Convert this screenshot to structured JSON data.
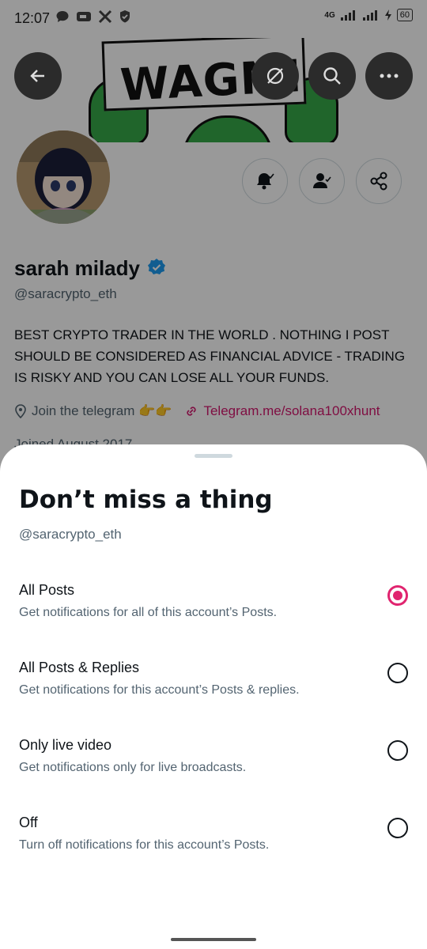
{
  "status_bar": {
    "time": "12:07",
    "network": "4G",
    "battery": "60"
  },
  "banner": {
    "sign_text": "WAGMI"
  },
  "profile": {
    "name": "sarah milady",
    "handle": "@saracrypto_eth",
    "bio": "BEST CRYPTO TRADER IN THE WORLD . NOTHING I POST SHOULD BE CONSIDERED AS FINANCIAL ADVICE - TRADING IS RISKY AND YOU CAN LOSE ALL YOUR FUNDS.",
    "location": "Join the telegram 👉👉",
    "link": "Telegram.me/solana100xhunt",
    "joined": "Joined August 2017"
  },
  "sheet": {
    "title": "Don’t miss a thing",
    "subtitle": "@saracrypto_eth",
    "options": [
      {
        "title": "All Posts",
        "desc": "Get notifications for all of this account’s Posts.",
        "selected": true
      },
      {
        "title": "All Posts & Replies",
        "desc": "Get notifications for this account’s Posts & replies.",
        "selected": false
      },
      {
        "title": "Only live video",
        "desc": "Get notifications only for live broadcasts.",
        "selected": false
      },
      {
        "title": "Off",
        "desc": "Turn off notifications for this account’s Posts.",
        "selected": false
      }
    ]
  },
  "colors": {
    "accent": "#e0246f",
    "link": "#d4186f",
    "verified": "#1d9bf0",
    "secondary_text": "#536471"
  }
}
